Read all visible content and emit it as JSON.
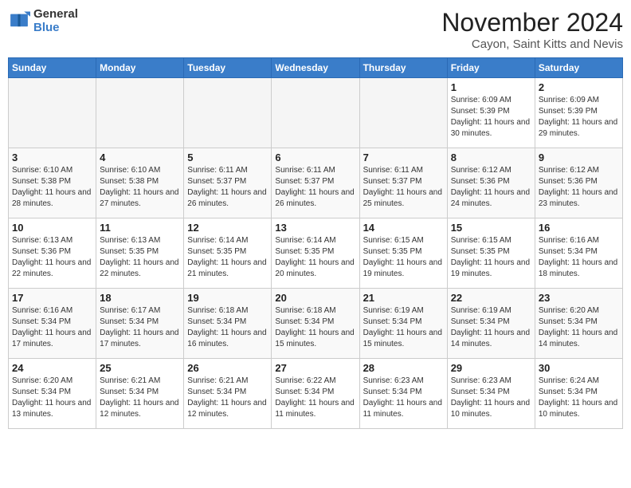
{
  "header": {
    "logo_general": "General",
    "logo_blue": "Blue",
    "month_title": "November 2024",
    "location": "Cayon, Saint Kitts and Nevis"
  },
  "weekdays": [
    "Sunday",
    "Monday",
    "Tuesday",
    "Wednesday",
    "Thursday",
    "Friday",
    "Saturday"
  ],
  "weeks": [
    [
      {
        "day": "",
        "info": ""
      },
      {
        "day": "",
        "info": ""
      },
      {
        "day": "",
        "info": ""
      },
      {
        "day": "",
        "info": ""
      },
      {
        "day": "",
        "info": ""
      },
      {
        "day": "1",
        "info": "Sunrise: 6:09 AM\nSunset: 5:39 PM\nDaylight: 11 hours and 30 minutes."
      },
      {
        "day": "2",
        "info": "Sunrise: 6:09 AM\nSunset: 5:39 PM\nDaylight: 11 hours and 29 minutes."
      }
    ],
    [
      {
        "day": "3",
        "info": "Sunrise: 6:10 AM\nSunset: 5:38 PM\nDaylight: 11 hours and 28 minutes."
      },
      {
        "day": "4",
        "info": "Sunrise: 6:10 AM\nSunset: 5:38 PM\nDaylight: 11 hours and 27 minutes."
      },
      {
        "day": "5",
        "info": "Sunrise: 6:11 AM\nSunset: 5:37 PM\nDaylight: 11 hours and 26 minutes."
      },
      {
        "day": "6",
        "info": "Sunrise: 6:11 AM\nSunset: 5:37 PM\nDaylight: 11 hours and 26 minutes."
      },
      {
        "day": "7",
        "info": "Sunrise: 6:11 AM\nSunset: 5:37 PM\nDaylight: 11 hours and 25 minutes."
      },
      {
        "day": "8",
        "info": "Sunrise: 6:12 AM\nSunset: 5:36 PM\nDaylight: 11 hours and 24 minutes."
      },
      {
        "day": "9",
        "info": "Sunrise: 6:12 AM\nSunset: 5:36 PM\nDaylight: 11 hours and 23 minutes."
      }
    ],
    [
      {
        "day": "10",
        "info": "Sunrise: 6:13 AM\nSunset: 5:36 PM\nDaylight: 11 hours and 22 minutes."
      },
      {
        "day": "11",
        "info": "Sunrise: 6:13 AM\nSunset: 5:35 PM\nDaylight: 11 hours and 22 minutes."
      },
      {
        "day": "12",
        "info": "Sunrise: 6:14 AM\nSunset: 5:35 PM\nDaylight: 11 hours and 21 minutes."
      },
      {
        "day": "13",
        "info": "Sunrise: 6:14 AM\nSunset: 5:35 PM\nDaylight: 11 hours and 20 minutes."
      },
      {
        "day": "14",
        "info": "Sunrise: 6:15 AM\nSunset: 5:35 PM\nDaylight: 11 hours and 19 minutes."
      },
      {
        "day": "15",
        "info": "Sunrise: 6:15 AM\nSunset: 5:35 PM\nDaylight: 11 hours and 19 minutes."
      },
      {
        "day": "16",
        "info": "Sunrise: 6:16 AM\nSunset: 5:34 PM\nDaylight: 11 hours and 18 minutes."
      }
    ],
    [
      {
        "day": "17",
        "info": "Sunrise: 6:16 AM\nSunset: 5:34 PM\nDaylight: 11 hours and 17 minutes."
      },
      {
        "day": "18",
        "info": "Sunrise: 6:17 AM\nSunset: 5:34 PM\nDaylight: 11 hours and 17 minutes."
      },
      {
        "day": "19",
        "info": "Sunrise: 6:18 AM\nSunset: 5:34 PM\nDaylight: 11 hours and 16 minutes."
      },
      {
        "day": "20",
        "info": "Sunrise: 6:18 AM\nSunset: 5:34 PM\nDaylight: 11 hours and 15 minutes."
      },
      {
        "day": "21",
        "info": "Sunrise: 6:19 AM\nSunset: 5:34 PM\nDaylight: 11 hours and 15 minutes."
      },
      {
        "day": "22",
        "info": "Sunrise: 6:19 AM\nSunset: 5:34 PM\nDaylight: 11 hours and 14 minutes."
      },
      {
        "day": "23",
        "info": "Sunrise: 6:20 AM\nSunset: 5:34 PM\nDaylight: 11 hours and 14 minutes."
      }
    ],
    [
      {
        "day": "24",
        "info": "Sunrise: 6:20 AM\nSunset: 5:34 PM\nDaylight: 11 hours and 13 minutes."
      },
      {
        "day": "25",
        "info": "Sunrise: 6:21 AM\nSunset: 5:34 PM\nDaylight: 11 hours and 12 minutes."
      },
      {
        "day": "26",
        "info": "Sunrise: 6:21 AM\nSunset: 5:34 PM\nDaylight: 11 hours and 12 minutes."
      },
      {
        "day": "27",
        "info": "Sunrise: 6:22 AM\nSunset: 5:34 PM\nDaylight: 11 hours and 11 minutes."
      },
      {
        "day": "28",
        "info": "Sunrise: 6:23 AM\nSunset: 5:34 PM\nDaylight: 11 hours and 11 minutes."
      },
      {
        "day": "29",
        "info": "Sunrise: 6:23 AM\nSunset: 5:34 PM\nDaylight: 11 hours and 10 minutes."
      },
      {
        "day": "30",
        "info": "Sunrise: 6:24 AM\nSunset: 5:34 PM\nDaylight: 11 hours and 10 minutes."
      }
    ]
  ]
}
